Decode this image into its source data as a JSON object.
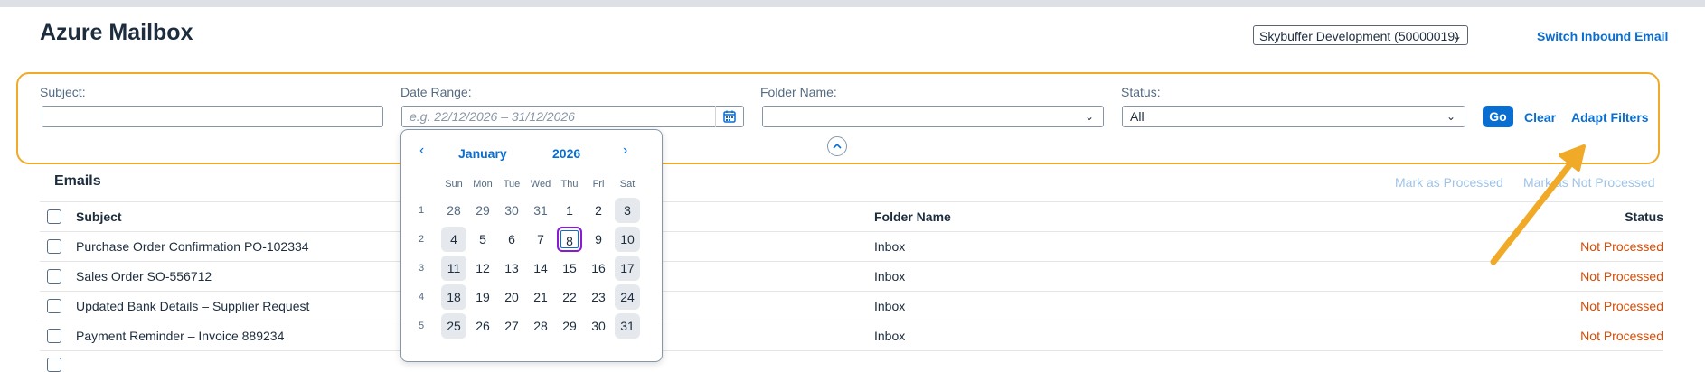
{
  "header": {
    "title": "Azure Mailbox",
    "system_select_value": "Skybuffer Development (50000019)",
    "switch_link": "Switch Inbound Email"
  },
  "filters": {
    "subject_label": "Subject:",
    "subject_value": "",
    "date_label": "Date Range:",
    "date_placeholder": "e.g. 22/12/2026 – 31/12/2026",
    "folder_label": "Folder Name:",
    "folder_value": "",
    "status_label": "Status:",
    "status_value": "All",
    "go": "Go",
    "clear": "Clear",
    "adapt": "Adapt Filters"
  },
  "calendar": {
    "month": "January",
    "year": "2026",
    "weekdays": [
      "Sun",
      "Mon",
      "Tue",
      "Wed",
      "Thu",
      "Fri",
      "Sat"
    ],
    "weeks": [
      {
        "num": "1",
        "days": [
          "28",
          "29",
          "30",
          "31",
          "1",
          "2",
          "3"
        ]
      },
      {
        "num": "2",
        "days": [
          "4",
          "5",
          "6",
          "7",
          "8",
          "9",
          "10"
        ]
      },
      {
        "num": "3",
        "days": [
          "11",
          "12",
          "13",
          "14",
          "15",
          "16",
          "17"
        ]
      },
      {
        "num": "4",
        "days": [
          "18",
          "19",
          "20",
          "21",
          "22",
          "23",
          "24"
        ]
      },
      {
        "num": "5",
        "days": [
          "25",
          "26",
          "27",
          "28",
          "29",
          "30",
          "31"
        ]
      }
    ],
    "today": "8"
  },
  "emails": {
    "title": "Emails",
    "mark_processed": "Mark as Processed",
    "mark_not_processed": "Mark as Not Processed",
    "columns": {
      "subject": "Subject",
      "folder": "Folder Name",
      "status": "Status"
    },
    "rows": [
      {
        "subject": "Purchase Order Confirmation PO-102334",
        "folder": "Inbox",
        "status": "Not Processed"
      },
      {
        "subject": "Sales Order SO-556712",
        "folder": "Inbox",
        "status": "Not Processed"
      },
      {
        "subject": "Updated Bank Details – Supplier Request",
        "folder": "Inbox",
        "status": "Not Processed"
      },
      {
        "subject": "Payment Reminder – Invoice 889234",
        "folder": "Inbox",
        "status": "Not Processed"
      }
    ]
  },
  "colors": {
    "accent": "#0a6ed1",
    "highlight": "#f0aa28",
    "status_not_processed": "#d94b00"
  }
}
